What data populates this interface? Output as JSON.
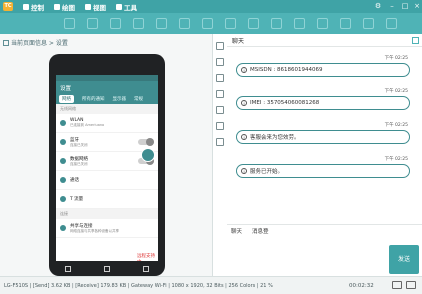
{
  "app": {
    "logo": "TC"
  },
  "menu": [
    {
      "label": "控制",
      "icon": "control-icon"
    },
    {
      "label": "绘图",
      "icon": "paint-icon"
    },
    {
      "label": "视图",
      "icon": "view-icon"
    },
    {
      "label": "工具",
      "icon": "tools-icon"
    }
  ],
  "breadcrumb": "当前页面信息 > 设置",
  "phone": {
    "header": "设置",
    "tabs": [
      "网络",
      "所有的通知",
      "显示器",
      "常规"
    ],
    "section_wireless": "无线网络",
    "rows": [
      {
        "title": "WLAN",
        "sub": "已连接到 Ameriuano"
      },
      {
        "title": "蓝牙",
        "sub": "连接已关闭"
      },
      {
        "title": "数据网络",
        "sub": "连接已关闭"
      },
      {
        "title": "通话",
        "sub": ""
      },
      {
        "title": "T 流量",
        "sub": ""
      }
    ],
    "section_connect": "连接",
    "share": {
      "title": "共享与连接",
      "sub": "网络连接与共享各种设备以共享"
    },
    "remote_label": "远程支持中"
  },
  "chat": {
    "title": "聊天",
    "messages": [
      {
        "time": "下午 02:25",
        "text": "MSISDN : 8618601944069"
      },
      {
        "time": "下午 02:25",
        "text": "IMEI : 357054060081268"
      },
      {
        "time": "下午 02:25",
        "text": "客服会来为您效劳。"
      },
      {
        "time": "下午 02:25",
        "text": "服务已开始。"
      }
    ],
    "input_tabs": [
      "聊天",
      "消息登"
    ],
    "send": "发送"
  },
  "status": {
    "text": "LG-F510S | [Send] 3.62 KB | [Receive] 179.83 KB | Gateway Wi-Fi | 1080 x 1920, 32 Bits | 256 Colors | 21 %",
    "time": "00:02:32"
  }
}
